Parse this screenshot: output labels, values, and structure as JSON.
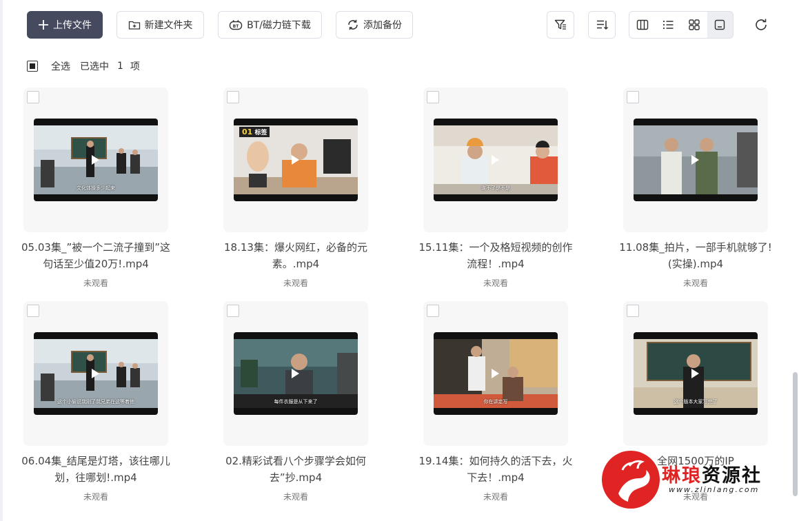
{
  "toolbar": {
    "upload_label": "上传文件",
    "new_folder_label": "新建文件夹",
    "bt_label": "BT/磁力链下载",
    "backup_label": "添加备份",
    "filter_icon": "filter-icon",
    "sort_icon": "sort-icon",
    "view_modes": [
      "column-view-icon",
      "list-view-icon",
      "grid-view-icon",
      "large-view-icon"
    ],
    "active_view": "large-view-icon",
    "refresh_icon": "refresh-icon"
  },
  "selection": {
    "select_all_label": "全选",
    "selected_prefix": "已选中",
    "selected_count": "1",
    "selected_suffix": "项"
  },
  "files": [
    {
      "title": "05.03集_”被一个二流子撞到”这句话至少值20万!.mp4",
      "status": "未观看",
      "subtitle": "文化体操多少起来",
      "scene": "classroom-blue"
    },
    {
      "title": "18.13集：爆火网红，必备的元素。.mp4",
      "status": "未观看",
      "subtitle": "",
      "tag_num": "01",
      "tag_text": "标签",
      "scene": "office-orange"
    },
    {
      "title": "15.11集：一个及格短视频的创作流程！.mp4",
      "status": "未观看",
      "subtitle": "谁不了是不是",
      "scene": "room-light"
    },
    {
      "title": "11.08集_拍片，一部手机就够了!(实操).mp4",
      "status": "未观看",
      "subtitle": "",
      "scene": "office-grey"
    },
    {
      "title": "06.04集_结尾是灯塔，该往哪儿划，往哪划!.mp4",
      "status": "未观看",
      "subtitle": "这个小偷说我刚了我兄弟在这等着他",
      "scene": "classroom-blue"
    },
    {
      "title": "02.精彩试看八个步骤学会如何去”抄.mp4",
      "status": "未观看",
      "subtitle": "每件衣服是从下来了",
      "scene": "office-teal"
    },
    {
      "title": "19.14集：如何持久的活下去，火下去！.mp4",
      "status": "未观看",
      "subtitle": "你在讲定写",
      "scene": "kitchen"
    },
    {
      "title": "全网1500万的IP",
      "status": "未观看",
      "subtitle": "这个版本大家写完了",
      "scene": "classroom-green"
    }
  ],
  "watermark": {
    "brand_a": "琳琅",
    "brand_b": "资源社",
    "site": "www.zlinlang.com"
  }
}
